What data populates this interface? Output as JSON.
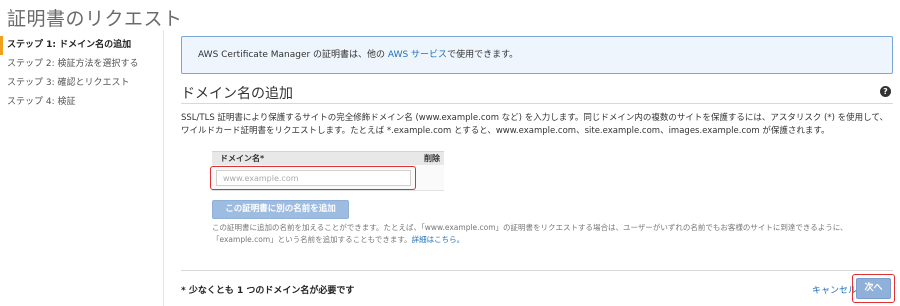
{
  "page": {
    "title": "証明書のリクエスト"
  },
  "steps": [
    {
      "label": "ステップ 1: ドメイン名の追加",
      "active": true
    },
    {
      "label": "ステップ 2: 検証方法を選択する",
      "active": false
    },
    {
      "label": "ステップ 3: 確認とリクエスト",
      "active": false
    },
    {
      "label": "ステップ 4: 検証",
      "active": false
    }
  ],
  "info": {
    "prefix": "AWS Certificate Manager の証明書は、他の ",
    "link": "AWS サービス",
    "suffix": "で使用できます。"
  },
  "section": {
    "title": "ドメイン名の追加",
    "help_icon": "?",
    "description": "SSL/TLS 証明書により保護するサイトの完全修飾ドメイン名 (www.example.com など) を入力します。同じドメイン内の複数のサイトを保護するには、アスタリスク (*) を使用して、ワイルドカード証明書をリクエストします。たとえば *.example.com とすると、www.example.com、site.example.com、images.example.com が保護されます。"
  },
  "table": {
    "col_domain": "ドメイン名*",
    "col_delete": "削除",
    "input_placeholder": "www.example.com",
    "input_value": ""
  },
  "add_button": {
    "label": "この証明書に別の名前を追加"
  },
  "note": {
    "text": "この証明書に追加の名前を加えることができます。たとえば、「www.example.com」の証明書をリクエストする場合は、ユーザーがいずれの名前でもお客様のサイトに到達できるように、「example.com」という名前を追加することもできます。",
    "link": "詳細はこちら。"
  },
  "footer": {
    "required_note": "* 少なくとも 1 つのドメイン名が必要です",
    "cancel_label": "キャンセル",
    "next_label": "次へ"
  },
  "colors": {
    "accent_step": "#f0a11c",
    "link": "#1f6fb8",
    "highlight": "#e03131",
    "button": "#8eb0d9"
  }
}
